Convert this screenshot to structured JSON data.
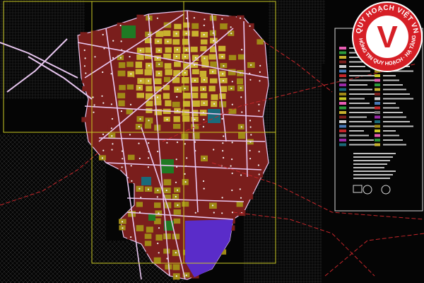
{
  "logo": {
    "letter": "V",
    "ring_top_text": "QUY HOẠCH VIỆT VN",
    "ring_bottom_text": "THÔNG TIN QUY HOẠCH · HẠ TẦNG",
    "colors": {
      "ring": "#d61f26",
      "inner": "#ffffff",
      "letter": "#d61f26",
      "ring_text": "#ffffff"
    }
  },
  "map": {
    "colors": {
      "background": "#050505",
      "residential": "#7a1e1c",
      "mixed_use": "#a08a16",
      "public": "#c9b22e",
      "green": "#1f7a24",
      "water": "#1a6a7a",
      "industrial": "#5a2cc9",
      "roads": "#e8c6f0",
      "frame": "#c9c925",
      "boundary": "#c4262a"
    },
    "legend_panel_border": "#d8d8d8"
  }
}
